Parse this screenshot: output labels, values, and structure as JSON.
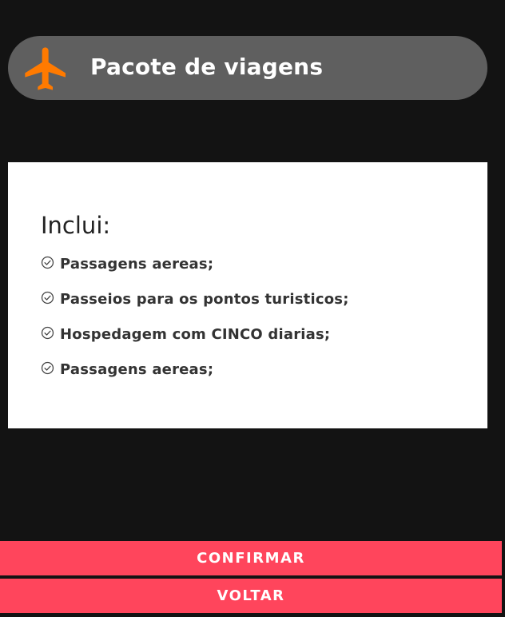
{
  "header": {
    "icon": "airplane-icon",
    "icon_color": "#ff7a00",
    "title": "Pacote de viagens"
  },
  "card": {
    "heading": "Inclui:",
    "items": [
      {
        "icon": "check-circle-icon",
        "label": "Passagens aereas;"
      },
      {
        "icon": "check-circle-icon",
        "label": "Passeios para os pontos turisticos;"
      },
      {
        "icon": "check-circle-icon",
        "label": "Hospedagem com CINCO diarias;"
      },
      {
        "icon": "check-circle-icon",
        "label": "Passagens aereas;"
      }
    ]
  },
  "buttons": {
    "confirm_label": "CONFIRMAR",
    "back_label": "VOLTAR",
    "color": "#ff455c"
  },
  "theme": {
    "background": "#131313",
    "header_background": "#5f5f5f"
  }
}
